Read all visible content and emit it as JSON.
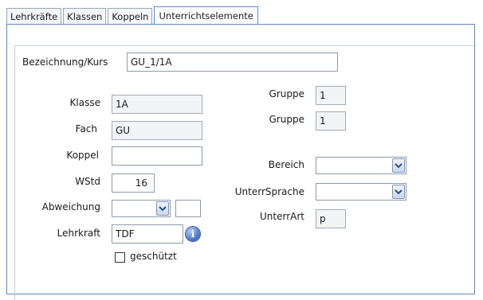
{
  "tabs": [
    {
      "label": "Lehrkräfte",
      "active": false
    },
    {
      "label": "Klassen",
      "active": false
    },
    {
      "label": "Koppeln",
      "active": false
    },
    {
      "label": "Unterrichtselemente",
      "active": true
    }
  ],
  "form": {
    "bezeichnung": {
      "label": "Bezeichnung/Kurs",
      "value": "GU_1/1A"
    },
    "klasse": {
      "label": "Klasse",
      "value": "1A"
    },
    "fach": {
      "label": "Fach",
      "value": "GU"
    },
    "koppel": {
      "label": "Koppel",
      "value": ""
    },
    "wstd": {
      "label": "WStd",
      "value": "16"
    },
    "abweichung": {
      "label": "Abweichung",
      "value": "",
      "extra": ""
    },
    "lehrkraft": {
      "label": "Lehrkraft",
      "value": "TDF",
      "info_icon": "info-icon"
    },
    "geschuetzt": {
      "label": "geschützt",
      "checked": false
    },
    "gruppe1": {
      "label": "Gruppe",
      "value": "1"
    },
    "gruppe2": {
      "label": "Gruppe",
      "value": "1"
    },
    "bereich": {
      "label": "Bereich",
      "value": ""
    },
    "unterrsprache": {
      "label": "UnterrSprache",
      "value": ""
    },
    "unterrart": {
      "label": "UnterrArt",
      "value": "p"
    }
  },
  "colors": {
    "accent_border": "#5b87c4",
    "combo_button": "#7a96c0",
    "info_icon": "#3f6fc0"
  }
}
